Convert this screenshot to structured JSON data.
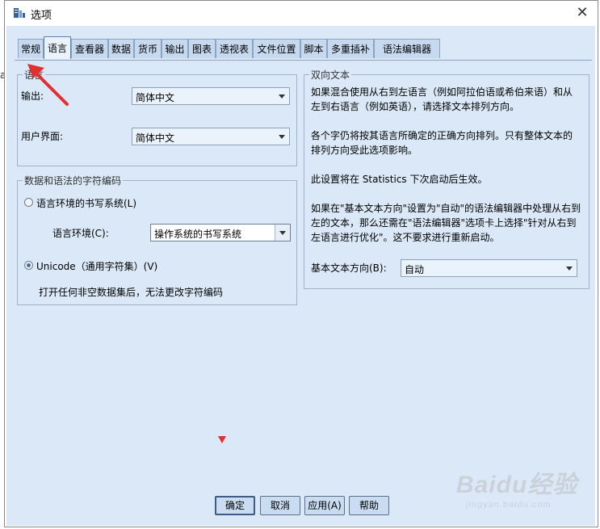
{
  "window": {
    "title": "选项",
    "close_label": "✕"
  },
  "side_char": "a",
  "tabs": [
    {
      "label": "常规"
    },
    {
      "label": "语言"
    },
    {
      "label": "查看器"
    },
    {
      "label": "数据"
    },
    {
      "label": "货币"
    },
    {
      "label": "输出"
    },
    {
      "label": "图表"
    },
    {
      "label": "透视表"
    },
    {
      "label": "文件位置"
    },
    {
      "label": "脚本"
    },
    {
      "label": "多重插补"
    },
    {
      "label": "语法编辑器"
    }
  ],
  "active_tab": "语言",
  "language_group": {
    "legend": "语言",
    "output_label": "输出:",
    "output_value": "简体中文",
    "ui_label": "用户界面:",
    "ui_value": "简体中文"
  },
  "encoding_group": {
    "legend": "数据和语法的字符编码",
    "locale_option": "语言环境的书写系统(L)",
    "locale_label": "语言环境(C):",
    "locale_value": "操作系统的书写系统",
    "unicode_option": "Unicode（通用字符集）(V)",
    "note": "打开任何非空数据集后，无法更改字符编码",
    "selected": "unicode"
  },
  "bidi_group": {
    "legend": "双向文本",
    "para1": [
      "如果混合使用从右到左语言（例如阿拉伯语或希伯来语）和从",
      "左到右语言（例如英语），请选择文本排列方向。"
    ],
    "para2": [
      "各个字仍将按其语言所确定的正确方向排列。只有整体文本的",
      "排列方向受此选项影响。"
    ],
    "para3": [
      "此设置将在 Statistics 下次启动后生效。"
    ],
    "para4": [
      "如果在\"基本文本方向\"设置为\"自动\"的语法编辑器中处理从右到",
      "左的文本，那么还需在\"语法编辑器\"选项卡上选择\"针对从右到",
      "左语言进行优化\"。这不要求进行重新启动。"
    ],
    "direction_label": "基本文本方向(B):",
    "direction_value": "自动"
  },
  "buttons": {
    "ok": "确定",
    "cancel": "取消",
    "apply": "应用(A)",
    "help": "帮助"
  },
  "watermark": {
    "main": "Baidu经验",
    "sub": "jingyan.baidu.com"
  },
  "colors": {
    "dialog_bg": "#dae8f7",
    "arrow": "#e03030"
  }
}
